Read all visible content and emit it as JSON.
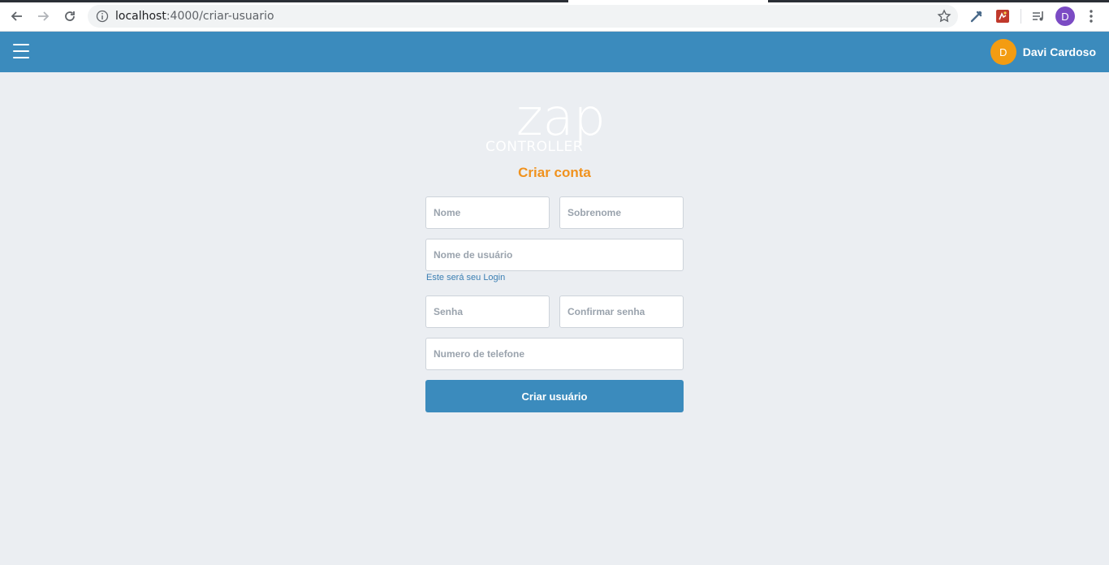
{
  "browser": {
    "url_host": "localhost",
    "url_rest": ":4000/criar-usuario",
    "profile_initial": "D"
  },
  "header": {
    "user_initial": "D",
    "user_name": "Davi Cardoso"
  },
  "logo": {
    "main": "zap",
    "sub": "CONTROLLER"
  },
  "form": {
    "title": "Criar conta",
    "first_name_placeholder": "Nome",
    "last_name_placeholder": "Sobrenome",
    "username_placeholder": "Nome de usuário",
    "username_hint": "Este será seu Login",
    "password_placeholder": "Senha",
    "confirm_password_placeholder": "Confirmar senha",
    "phone_placeholder": "Numero de telefone",
    "submit_label": "Criar usuário"
  },
  "colors": {
    "header_blue": "#3b8bbd",
    "accent_orange": "#f0921e",
    "avatar_orange": "#f39c12",
    "background": "#ebeef2"
  }
}
